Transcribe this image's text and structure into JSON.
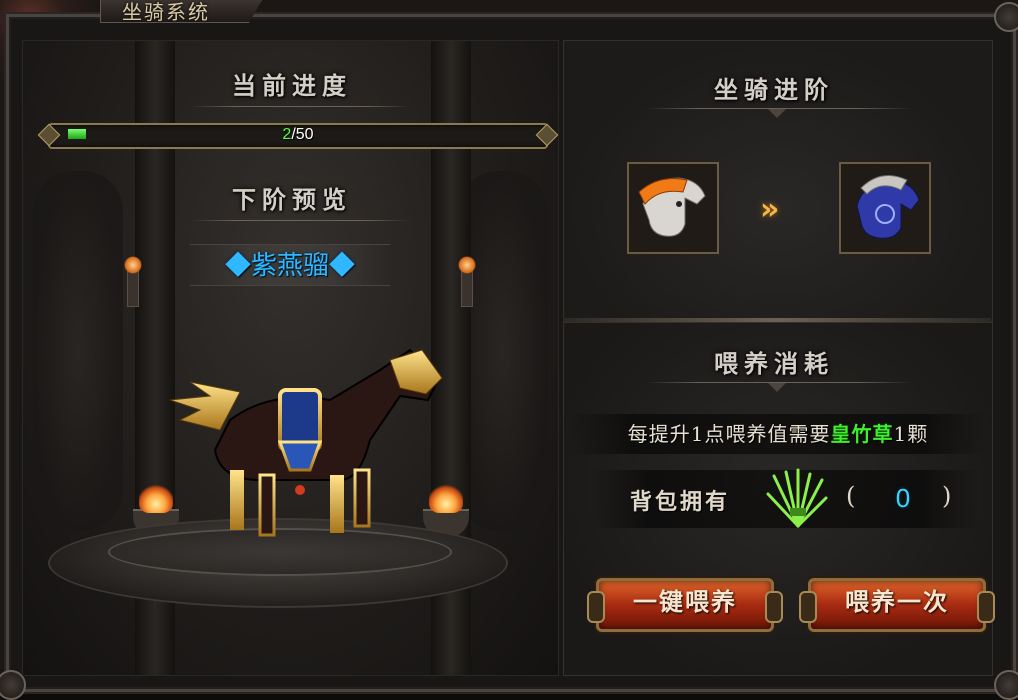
{
  "window": {
    "title": "坐骑系统"
  },
  "left": {
    "progress_heading": "当前进度",
    "progress": {
      "current": "2",
      "total": "/50",
      "fraction": 0.04
    },
    "preview_heading": "下阶预览",
    "preview_name": "◆紫燕骝◆"
  },
  "right": {
    "advance_heading": "坐骑进阶",
    "arrow": "»",
    "feed_heading": "喂养消耗",
    "consume": {
      "prefix": "每提升1点喂养值需要",
      "item": "皇竹草",
      "suffix": "1颗"
    },
    "own": {
      "label": "背包拥有",
      "open": "(",
      "count": "0",
      "close": ")"
    },
    "buttons": {
      "one_click": "一键喂养",
      "feed_once": "喂养一次"
    }
  },
  "colors": {
    "progress_green": "#55ff38",
    "preview_blue": "#2fb8ff",
    "item_green": "#3ef02c",
    "count_cyan": "#36d6ff",
    "button_red": "#a62a10"
  },
  "icons": [
    "current-mount-icon",
    "next-mount-icon",
    "advance-arrow-icon",
    "grass-item-icon",
    "horse-model"
  ]
}
